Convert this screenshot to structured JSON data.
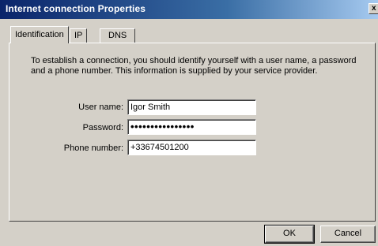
{
  "window": {
    "title": "Internet connection Properties",
    "close_glyph": "x"
  },
  "tabs": [
    {
      "label": "Identification",
      "active": true
    },
    {
      "label": "IP",
      "active": false
    },
    {
      "label": "DNS",
      "active": false
    }
  ],
  "identification": {
    "intro": "To establish a connection, you should identify yourself with a user name, a password and a phone number. This information is supplied by your service provider.",
    "username_label": "User name:",
    "username_value": "Igor Smith",
    "password_label": "Password:",
    "password_mask": "••••••••••••••••",
    "phone_label": "Phone number:",
    "phone_value": "+33674501200"
  },
  "buttons": {
    "ok_label": "OK",
    "cancel_label": "Cancel"
  },
  "colors": {
    "window_face": "#d4d0c8",
    "titlebar_start": "#0a246a",
    "titlebar_end": "#a6caf0"
  }
}
